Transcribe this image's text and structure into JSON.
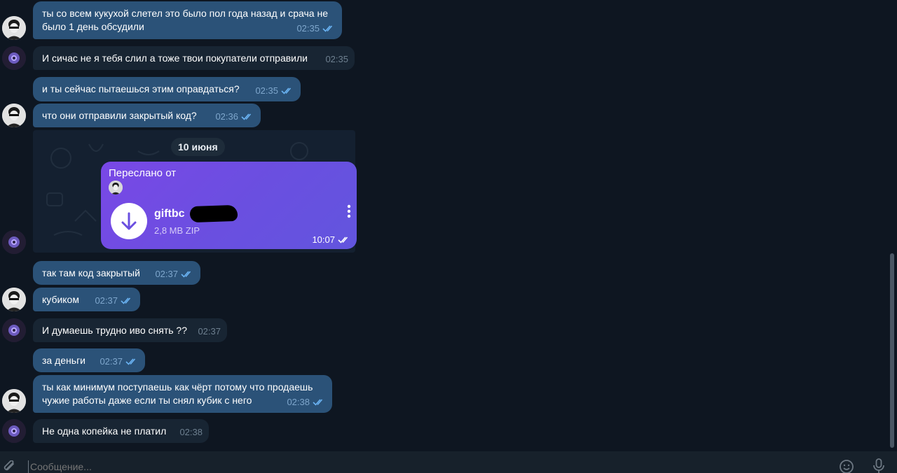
{
  "messages": [
    {
      "text": "ты со всем кукухой слетел это было пол года назад и срача не было 1 день обсудили",
      "time": "02:35"
    },
    {
      "text": "И сичас не я тебя слил а тоже твои покупатели отправили",
      "time": "02:35"
    },
    {
      "text": "и ты сейчас пытаешься этим оправдаться?",
      "time": "02:35"
    },
    {
      "text": "что они отправили закрытый код?",
      "time": "02:36"
    },
    {
      "text": "так там код закрытый",
      "time": "02:37"
    },
    {
      "text": "кубиком",
      "time": "02:37"
    },
    {
      "text": "И думаешь трудно иво снять ??",
      "time": "02:37"
    },
    {
      "text": "за деньги",
      "time": "02:37"
    },
    {
      "text": "ты как минимум поступаешь как чёрт потому что продаешь чужие работы даже если ты снял кубик с него",
      "time": "02:38"
    },
    {
      "text": "Не одна копейка не платил",
      "time": "02:38"
    }
  ],
  "date_separator": "10 июня",
  "forwarded": {
    "label": "Переслано от",
    "file_name": "giftbc",
    "file_size": "2,8 MB ZIP",
    "time": "10:07"
  },
  "composer": {
    "placeholder": "Сообщение..."
  },
  "icons": {
    "attach": "paperclip-icon",
    "emoji": "smile-icon",
    "mic": "microphone-icon",
    "download": "download-arrow-icon",
    "menu": "more-vertical-icon",
    "read": "double-check-icon"
  },
  "colors": {
    "background": "#0e1621",
    "outgoing_bubble": "#2b5278",
    "incoming_bubble": "#182533",
    "forward_gradient_start": "#7948e6",
    "forward_gradient_end": "#6255de",
    "check_color": "#6ab3f3"
  }
}
